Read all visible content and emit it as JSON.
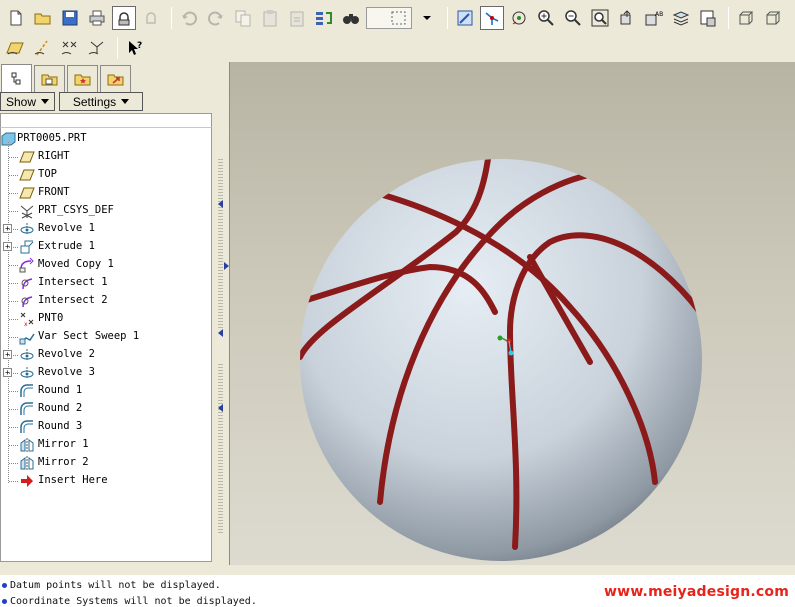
{
  "navigator": {
    "show_label": "Show",
    "settings_label": "Settings",
    "tabs": [
      "model-tree",
      "folder-browser",
      "favorites",
      "connections"
    ]
  },
  "model_tree": {
    "root": "PRT0005.PRT",
    "items": [
      {
        "label": "RIGHT",
        "icon": "datum-plane-icon",
        "expandable": false
      },
      {
        "label": "TOP",
        "icon": "datum-plane-icon",
        "expandable": false
      },
      {
        "label": "FRONT",
        "icon": "datum-plane-icon",
        "expandable": false
      },
      {
        "label": "PRT_CSYS_DEF",
        "icon": "coordinate-system-icon",
        "expandable": false
      },
      {
        "label": "Revolve 1",
        "icon": "revolve-icon",
        "expandable": true
      },
      {
        "label": "Extrude 1",
        "icon": "extrude-icon",
        "expandable": true
      },
      {
        "label": "Moved Copy 1",
        "icon": "moved-copy-icon",
        "expandable": false
      },
      {
        "label": "Intersect 1",
        "icon": "intersect-icon",
        "expandable": false
      },
      {
        "label": "Intersect 2",
        "icon": "intersect-icon",
        "expandable": false
      },
      {
        "label": "PNT0",
        "icon": "datum-point-icon",
        "expandable": false
      },
      {
        "label": "Var Sect Sweep 1",
        "icon": "sweep-icon",
        "expandable": false
      },
      {
        "label": "Revolve 2",
        "icon": "revolve-icon",
        "expandable": true
      },
      {
        "label": "Revolve 3",
        "icon": "revolve-icon",
        "expandable": true
      },
      {
        "label": "Round 1",
        "icon": "round-icon",
        "expandable": false
      },
      {
        "label": "Round 2",
        "icon": "round-icon",
        "expandable": false
      },
      {
        "label": "Round 3",
        "icon": "round-icon",
        "expandable": false
      },
      {
        "label": "Mirror 1",
        "icon": "mirror-icon",
        "expandable": false
      },
      {
        "label": "Mirror 2",
        "icon": "mirror-icon",
        "expandable": false
      },
      {
        "label": "Insert Here",
        "icon": "insert-here-icon",
        "expandable": false
      }
    ]
  },
  "messages": [
    "Datum points will not be displayed.",
    "Coordinate Systems will not be displayed."
  ],
  "watermark": "www.meiyadesign.com",
  "colors": {
    "seam": "#8b1a1a",
    "ball_light": "#e6edf4",
    "ball_dark": "#55606b",
    "watermark": "#e8231b",
    "message_bullet": "#1b3fd1"
  }
}
